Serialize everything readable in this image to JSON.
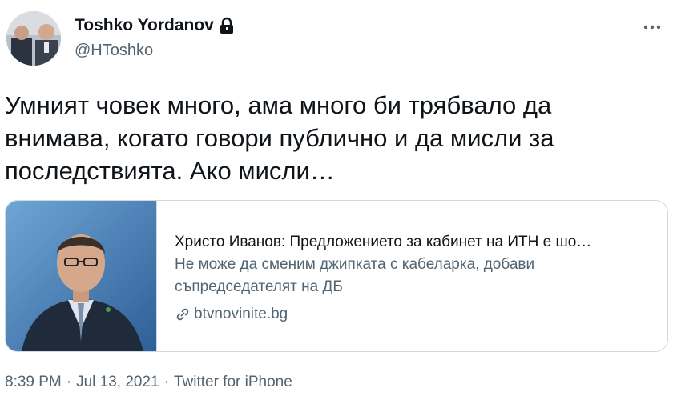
{
  "author": {
    "display_name": "Toshko Yordanov",
    "handle": "@HToshko",
    "protected_icon": "lock-icon",
    "avatar": "avatar"
  },
  "more_icon": "more-icon",
  "tweet": {
    "text": "Умният човек много, ама много би трябвало да внимава, когато говори публично и да мисли за последствията. Ако мисли…"
  },
  "card": {
    "title": "Христо Иванов: Предложението за кабинет на ИТН е шо…",
    "description": "Не може да сменим джипката с кабеларка, добави съпредседателят на ДБ",
    "domain": "btvnovinite.bg",
    "thumbnail": "news-thumbnail",
    "link_icon": "link-icon"
  },
  "meta": {
    "time": "8:39 PM",
    "date": "Jul 13, 2021",
    "source": "Twitter for iPhone",
    "separator": "·"
  }
}
